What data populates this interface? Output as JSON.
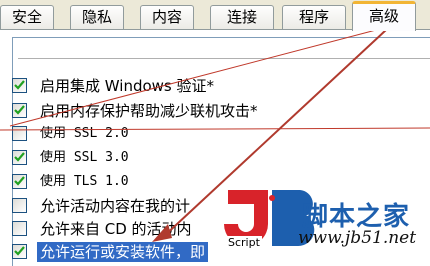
{
  "tabs": [
    {
      "label": "安全",
      "active": false
    },
    {
      "label": "隐私",
      "active": false
    },
    {
      "label": "内容",
      "active": false
    },
    {
      "label": "连接",
      "active": false
    },
    {
      "label": "程序",
      "active": false
    },
    {
      "label": "高级",
      "active": true
    }
  ],
  "options": [
    {
      "label": "启用集成 Windows 验证*",
      "checked": true
    },
    {
      "label": "启用内存保护帮助减少联机攻击*",
      "checked": true
    },
    {
      "label": "使用 SSL 2.0",
      "checked": false
    },
    {
      "label": "使用 SSL 3.0",
      "checked": true
    },
    {
      "label": "使用 TLS 1.0",
      "checked": true
    },
    {
      "label": "允许活动内容在我的计",
      "checked": false
    },
    {
      "label": "允许来自 CD 的活动内",
      "checked": false
    },
    {
      "label": "允许运行或安装软件，即",
      "checked": true,
      "selected": true
    }
  ],
  "watermark": {
    "letter": "JB",
    "script_label": "Script",
    "site_name": "脚本之家",
    "site_url": "www.jb51.net"
  },
  "colors": {
    "accent_tab": "#f2b535",
    "selection": "#316ac5",
    "checkmark": "#21a121",
    "annotation_arrow": "#c0392b",
    "watermark_red": "#d8232a",
    "watermark_blue": "#1d5fae"
  }
}
